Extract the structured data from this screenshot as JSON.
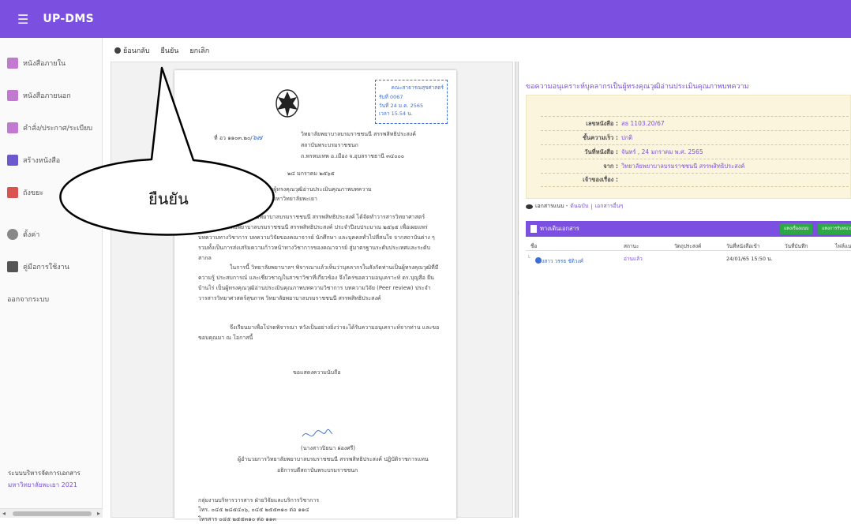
{
  "app": {
    "title": "UP-DMS",
    "brand_color": "#7b4fe0"
  },
  "sidebar": {
    "items": [
      {
        "label": "หนังสือภายใน",
        "icon": "inbox-doc-icon",
        "color": "#c27ad0"
      },
      {
        "label": "หนังสือภายนอก",
        "icon": "outbox-doc-icon",
        "color": "#c27ad0"
      },
      {
        "label": "คำสั่ง/ประกาศ/ระเบียบ",
        "icon": "announcement-icon",
        "color": "#c27ad0"
      },
      {
        "label": "สร้างหนังสือ",
        "icon": "create-doc-icon",
        "color": "#6a5acd"
      },
      {
        "label": "ถังขยะ",
        "icon": "trash-icon",
        "color": "#d9534f"
      },
      {
        "label": "ตั้งค่า",
        "icon": "gear-icon",
        "color": "#888888"
      },
      {
        "label": "คู่มือการใช้งาน",
        "icon": "manual-icon",
        "color": "#555555"
      },
      {
        "label": "ออกจากระบบ",
        "icon": "",
        "color": ""
      }
    ],
    "footer_line1": "ระบบบริหารจัดการเอกสาร",
    "footer_line2": "มหาวิทยาลัยพะเยา 2021"
  },
  "toolbar": {
    "back": "ย้อนกลับ",
    "confirm": "ยืนยัน",
    "cancel": "ยกเลิก"
  },
  "document": {
    "stamp": {
      "line1": "คณะสาธารณสุขศาสตร์",
      "line2": "รับที่ 0067",
      "line3": "วันที่ 24 ม.ค. 2565",
      "line4": "เวลา 15.54 น."
    },
    "ref_no": "ที่ อว ๑๑๐๓.๒๐/",
    "ref_hand": "๖๗",
    "sender_line1": "วิทยาลัยพยาบาลบรมราชชนนี สรรพสิทธิประสงค์",
    "sender_line2": "สถาบันพระบรมราชชนก",
    "sender_line3": "ถ.พรหมเทพ อ.เมือง จ.อุบลราชธานี ๓๔๐๐๐",
    "date": "๒๔ มกราคม ๒๕๖๕",
    "subject": "ขอความอนุเคราะห์บุคลากรเป็นผู้ทรงคุณวุฒิอ่านประเมินคุณภาพบทความ",
    "to": "คณบดีคณะสาธารณสุขศาสตร์ มหาวิทยาลัยพะเยา",
    "para1": "ด้วยวิทยาลัยพยาบาลบรมราชชนนี สรรพสิทธิประสงค์ ได้จัดทำวารสารวิทยาศาสตร์สุขภาพ วิทยาลัยพยาบาลบรมราชชนนี สรรพสิทธิประสงค์ ประจำปีงบประมาณ ๒๕๖๕ เพื่อเผยแพร่บทความทางวิชาการ บทความวิจัยของคณาจารย์ นักศึกษา และบุคคลทั่วไปที่สนใจ จากสถาบันต่าง ๆ รวมทั้งเป็นการส่งเสริมความก้าวหน้าทางวิชาการของคณาจารย์ สู่มาตรฐานระดับประเทศและระดับสากล",
    "para2": "ในการนี้ วิทยาลัยพยาบาลฯ พิจารณาแล้วเห็นว่าบุคลากรในสังกัดท่านเป็นผู้ทรงคุณวุฒิที่มีความรู้ ประสบการณ์ และเชี่ยวชาญในสาขาวิชาที่เกี่ยวข้อง จึงใคร่ขอความอนุเคราะห์ ดร.บุญสือ ยืนบ้านไร่ เป็นผู้ทรงคุณวุฒิอ่านประเมินคุณภาพบทความวิชาการ บทความวิจัย (Peer review) ประจำวารสารวิทยาศาสตร์สุขภาพ วิทยาลัยพยาบาลบรมราชชนนี สรรพสิทธิประสงค์",
    "para3": "จึงเรียนมาเพื่อโปรดพิจารณา หวังเป็นอย่างยิ่งว่าจะได้รับความอนุเคราะห์จากท่าน และขอขอบคุณมา ณ โอกาสนี้",
    "closing": "ขอแสดงความนับถือ",
    "signer_name": "(นางสาวปิยนา ผ่องศรี)",
    "signer_title1": "ผู้อำนวยการวิทยาลัยพยาบาลบรมราชชนนี สรรพสิทธิประสงค์ ปฏิบัติราชการแทน",
    "signer_title2": "อธิการบดีสถาบันพระบรมราชชนก",
    "footer1": "กลุ่มงานบริหารวารสาร ฝ่ายวิจัยและบริการวิชาการ",
    "footer2": "โทร. ๐๔๕ ๒๘๕๔๐๖, ๐๔๕ ๒๕๕๓๑๐ ต่อ ๑๑๔",
    "footer3": "โทรสาร ๐๔๕ ๒๕๕๓๑๐ ต่อ ๑๑๓"
  },
  "detail": {
    "title": "ขอความอนุเคราะห์บุคลากรเป็นผู้ทรงคุณวุฒิอ่านประเมินคุณภาพบทความ",
    "rows": [
      {
        "label": "เลขหนังสือ :",
        "value": "สธ 1103.20/67"
      },
      {
        "label": "ชั้นความเร็ว :",
        "value": "ปกติ"
      },
      {
        "label": "วันที่หนังสือ :",
        "value": "จันทร์ , 24 มกราคม พ.ศ. 2565"
      },
      {
        "label": "จาก :",
        "value": "วิทยาลัยพยาบาลบรมราชชนนี สรรพสิทธิประสงค์"
      },
      {
        "label": "เจ้าของเรื่อง :",
        "value": ""
      }
    ],
    "attach_label": "เอกสารแนบ -",
    "attach_link1": "ต้นฉบับ",
    "attach_sep": "|",
    "attach_link2": "เอกสารอื่นๆ",
    "trail_title": "ทางเดินเอกสาร",
    "trail_btn1": "แทงเรื่องแนบ",
    "trail_btn2": "แทงการรับหน่วยงาน",
    "columns": [
      "ชื่อ",
      "สถานะ",
      "วัตถุประสงค์",
      "วันที่หนังสือเข้า",
      "วันที่บันทึก",
      "ไฟล์แนบ"
    ],
    "row": {
      "name": "นางสาว วรรธ ชัติวงศ์",
      "status": "อ่านแล้ว",
      "purpose": "",
      "received": "24/01/65 15:50 น.",
      "saved": "",
      "file": ""
    }
  },
  "callout": {
    "text": "ยืนยัน"
  }
}
